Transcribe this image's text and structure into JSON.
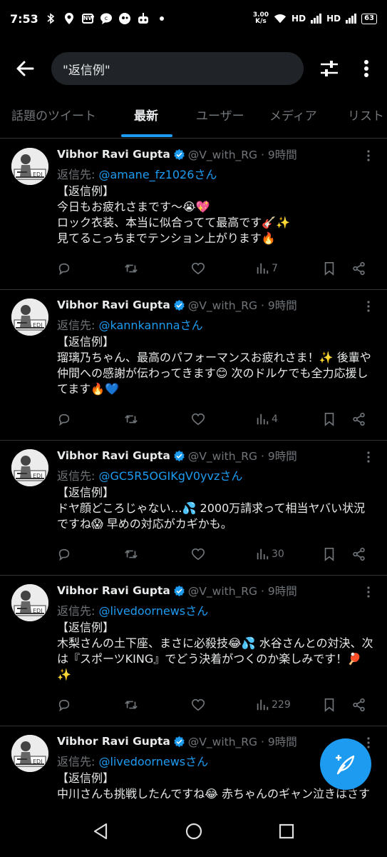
{
  "status_bar": {
    "time": "7:53",
    "net_speed_value": "3.00",
    "net_speed_unit": "K/s",
    "hd1": "HD",
    "hd2": "HD",
    "battery": "63"
  },
  "search": {
    "query": "\"返信例\""
  },
  "tabs": [
    {
      "label": "話題のツイート",
      "active": false
    },
    {
      "label": "最新",
      "active": true
    },
    {
      "label": "ユーザー",
      "active": false
    },
    {
      "label": "メディア",
      "active": false
    },
    {
      "label": "リスト",
      "active": false
    }
  ],
  "reply_prefix": "返信先: ",
  "colors": {
    "accent": "#1d9bf0",
    "background": "#000000",
    "muted": "#71767b"
  },
  "tweets": [
    {
      "name": "Vibhor Ravi Gupta",
      "handle": "@V_with_RG · 9時間",
      "mention": "@amane_fz1026さん",
      "text": "【返信例】\n今日もお疲れさまです〜😭💖\nロック衣装、本当に似合ってて最高です🎸✨\n見てるこっちまでテンション上がります🔥",
      "views": "7"
    },
    {
      "name": "Vibhor Ravi Gupta",
      "handle": "@V_with_RG · 9時間",
      "mention": "@kannkannnaさん",
      "text": "【返信例】\n瑠璃乃ちゃん、最高のパフォーマンスお疲れさま！✨ 後輩や仲間への感謝が伝わってきます😊 次のドルケでも全力応援してます🔥💙",
      "views": "4"
    },
    {
      "name": "Vibhor Ravi Gupta",
      "handle": "@V_with_RG · 9時間",
      "mention": "@GC5R5OGIKgV0yvzさん",
      "text": "【返信例】\nドヤ顔どころじゃない…💦 2000万請求って相当ヤバい状況ですね😱 早めの対応がカギかも。",
      "views": "30"
    },
    {
      "name": "Vibhor Ravi Gupta",
      "handle": "@V_with_RG · 9時間",
      "mention": "@livedoornewsさん",
      "text": "【返信例】\n木梨さんの土下座、まさに必殺技😂💦 水谷さんとの対決、次は『スポーツKING』でどう決着がつくのか楽しみです！🏓✨",
      "views": "229"
    },
    {
      "name": "Vibhor Ravi Gupta",
      "handle": "@V_with_RG · 9時間",
      "mention": "@livedoornewsさん",
      "text": "【返信例】\n中川さんも挑戦したんですね😂 赤ちゃんのギャン泣きはさすがに反町さんも手ごわい…！双子ちゃんたち、元気いっぱいで何よりです😂",
      "views": ""
    }
  ]
}
